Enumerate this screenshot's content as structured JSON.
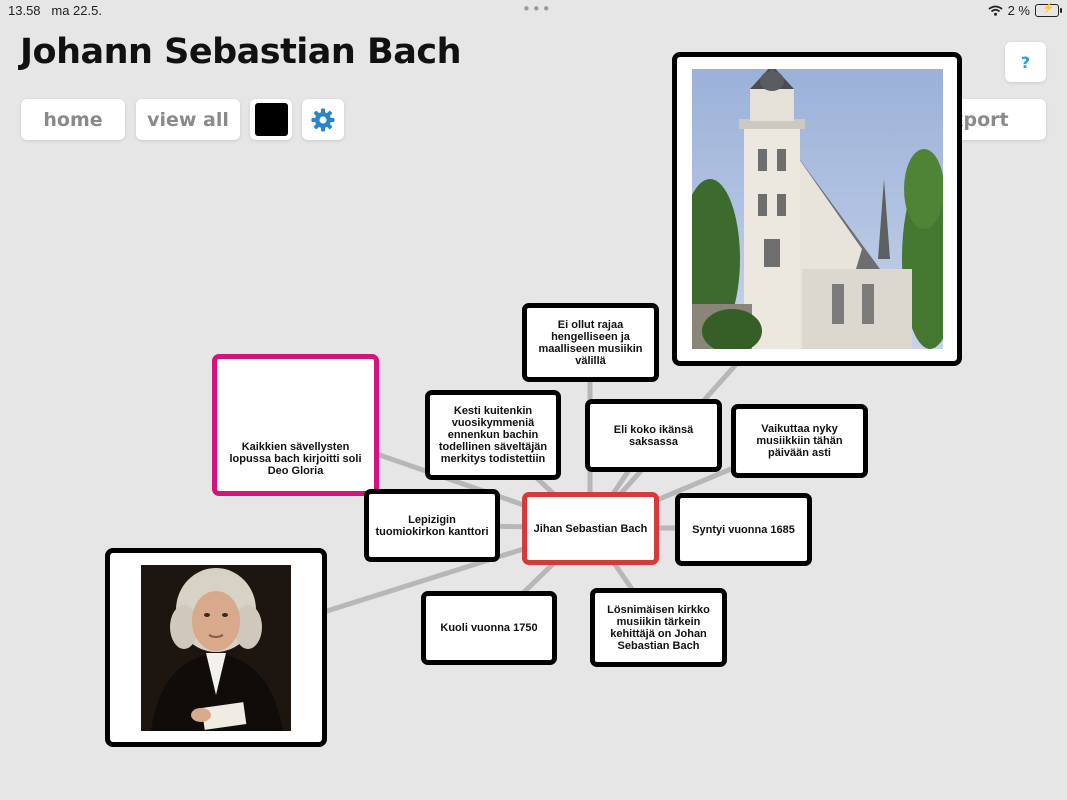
{
  "status": {
    "time": "13.58",
    "date": "ma 22.5.",
    "battery": "2 %"
  },
  "title": "Johann Sebastian Bach",
  "toolbar": {
    "home": "home",
    "view_all": "view all",
    "export": "export",
    "help": "?"
  },
  "colors": {
    "center_border": "#d83a3a",
    "highlight_border": "#d4147c",
    "settings_icon": "#2a86c8",
    "help_icon": "#2aa0d8"
  },
  "nodes": {
    "center": "Jihan Sebastian Bach",
    "n1": "Ei ollut rajaa hengelliseen ja maalliseen musiikin välillä",
    "n2": "Kesti kuitenkin vuosikymmeniä ennenkun bachin todellinen säveltäjän merkitys todistettiin",
    "n3": "Eli koko ikänsä saksassa",
    "n4": "Vaikuttaa nyky musiikkiin tähän päivään asti",
    "n5": "Kaikkien sävellysten lopussa bach kirjoitti soli Deo Gloria",
    "n6": "Lepizigin tuomiokirkon kanttori",
    "n7": "Syntyi vuonna 1685",
    "n8": "Kuoli vuonna 1750",
    "n9": "Lösnimäisen kirkko musiikin tärkein kehittäjä on Johan Sebastian Bach"
  },
  "images": {
    "church": "church-photo",
    "portrait": "bach-portrait"
  }
}
